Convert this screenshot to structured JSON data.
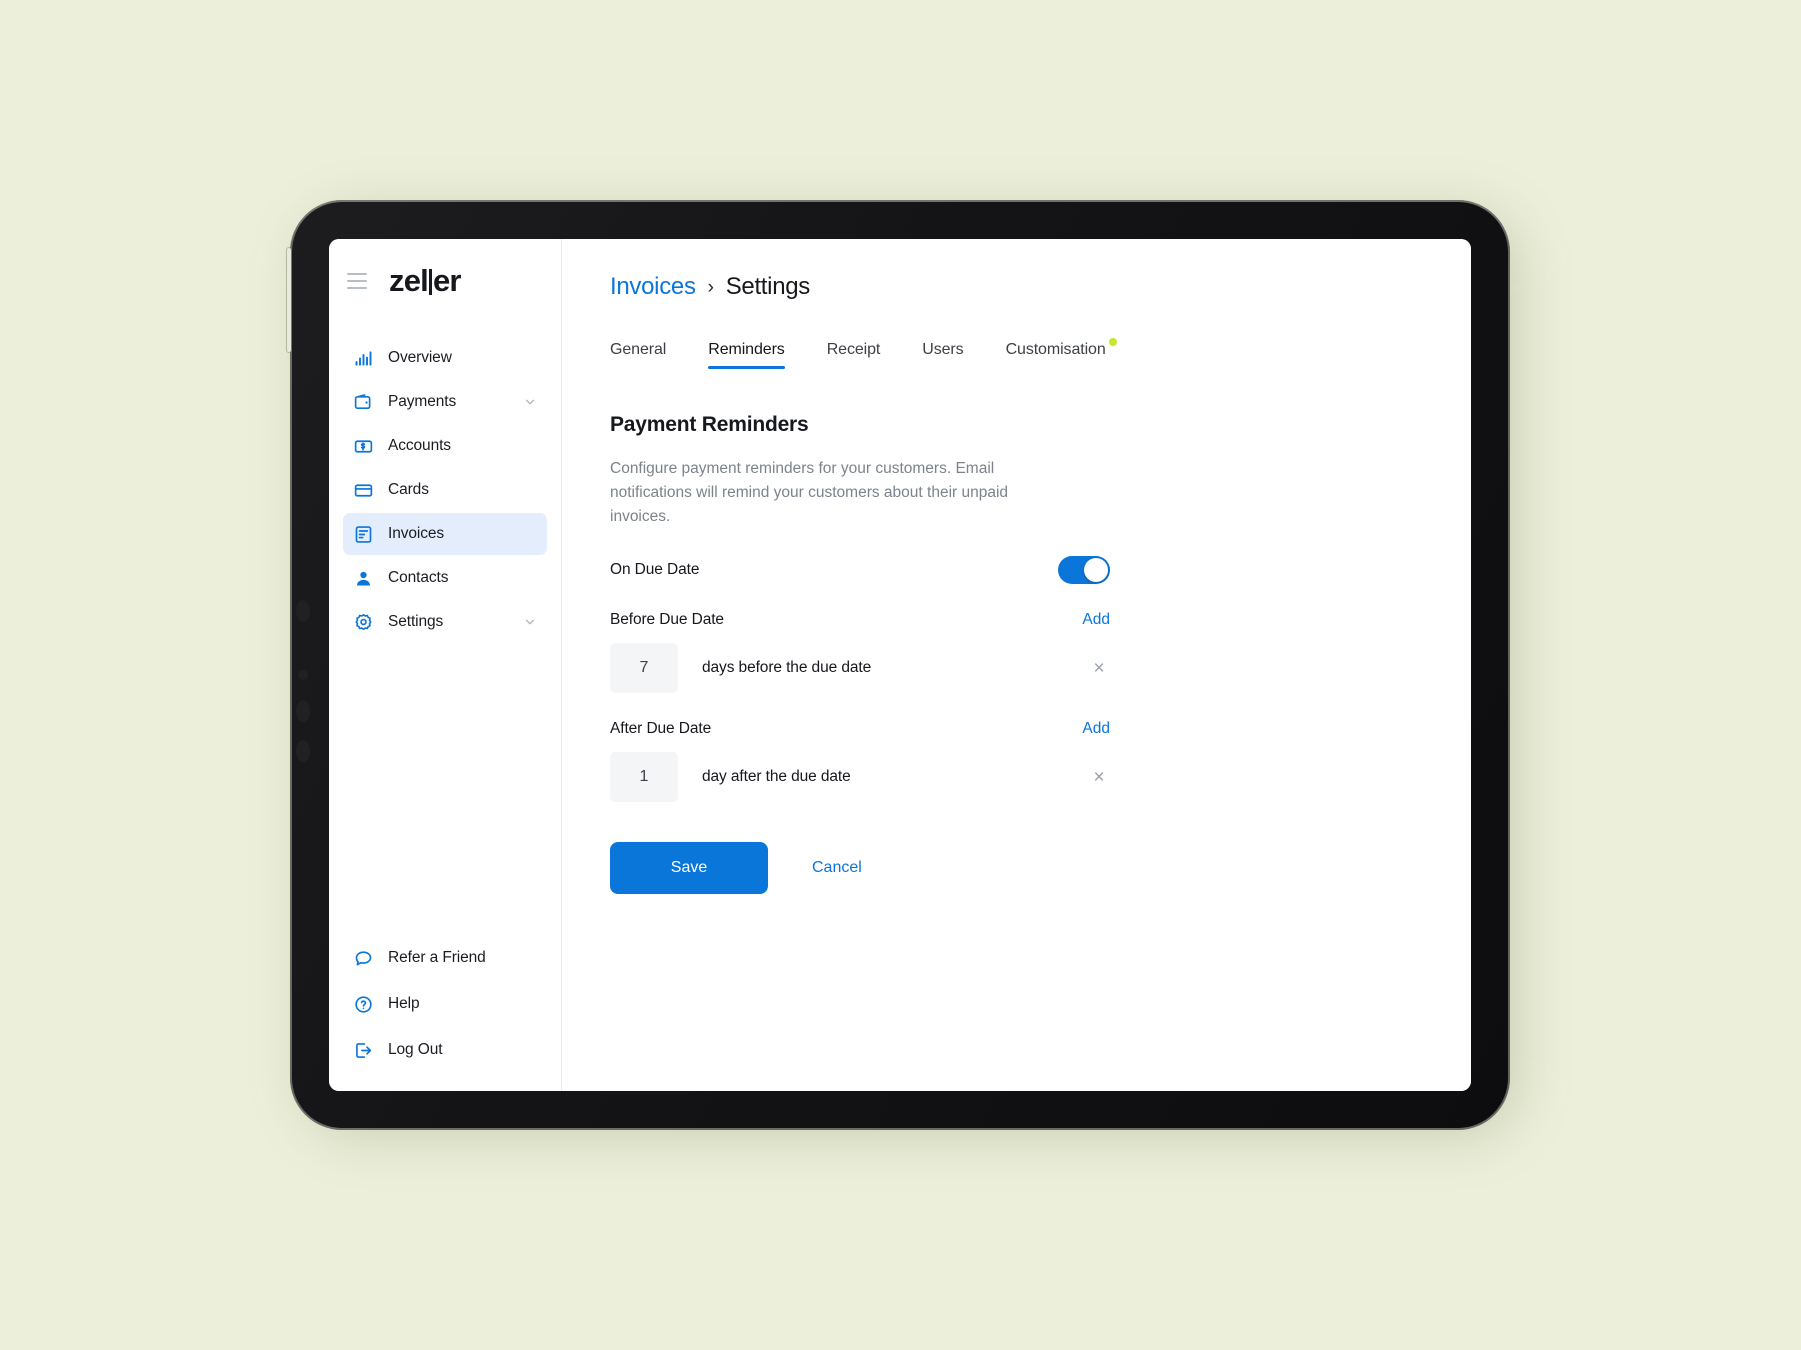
{
  "brand": {
    "name": "zeller",
    "before": "zel",
    "after": "er"
  },
  "sidebar": {
    "items": [
      {
        "label": "Overview",
        "icon": "bar-chart-icon",
        "chevron": false,
        "active": false
      },
      {
        "label": "Payments",
        "icon": "wallet-icon",
        "chevron": true,
        "active": false
      },
      {
        "label": "Accounts",
        "icon": "banknote-icon",
        "chevron": false,
        "active": false
      },
      {
        "label": "Cards",
        "icon": "card-icon",
        "chevron": false,
        "active": false
      },
      {
        "label": "Invoices",
        "icon": "invoice-icon",
        "chevron": false,
        "active": true
      },
      {
        "label": "Contacts",
        "icon": "person-icon",
        "chevron": false,
        "active": false
      },
      {
        "label": "Settings",
        "icon": "gear-icon",
        "chevron": true,
        "active": false
      }
    ],
    "bottom_items": [
      {
        "label": "Refer a Friend",
        "icon": "speech-bubble-icon"
      },
      {
        "label": "Help",
        "icon": "question-circle-icon"
      },
      {
        "label": "Log Out",
        "icon": "logout-icon"
      }
    ]
  },
  "breadcrumb": {
    "parent": "Invoices",
    "separator": "›",
    "current": "Settings"
  },
  "tabs": [
    {
      "label": "General",
      "active": false,
      "badge": false
    },
    {
      "label": "Reminders",
      "active": true,
      "badge": false
    },
    {
      "label": "Receipt",
      "active": false,
      "badge": false
    },
    {
      "label": "Users",
      "active": false,
      "badge": false
    },
    {
      "label": "Customisation",
      "active": false,
      "badge": true
    }
  ],
  "content": {
    "title": "Payment Reminders",
    "description": "Configure payment reminders for your customers. Email notifications will remind your customers about their unpaid invoices.",
    "on_due_date": {
      "label": "On Due Date",
      "toggle_on": true
    },
    "before_due_date": {
      "label": "Before Due Date",
      "add_label": "Add",
      "rows": [
        {
          "value": "7",
          "unit": "days before the due date",
          "remove": "×"
        }
      ]
    },
    "after_due_date": {
      "label": "After Due Date",
      "add_label": "Add",
      "rows": [
        {
          "value": "1",
          "unit": "day after the due date",
          "remove": "×"
        }
      ]
    },
    "save_label": "Save",
    "cancel_label": "Cancel"
  },
  "colors": {
    "accent": "#0b76d9",
    "badge": "#c5e82b",
    "active_nav_bg": "#e4edfb",
    "page_bg": "#ecefd9"
  }
}
